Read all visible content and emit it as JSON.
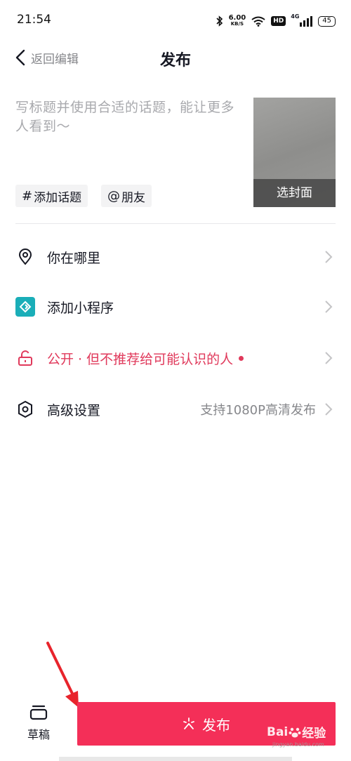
{
  "status_bar": {
    "time": "21:54",
    "net_speed": "6.00",
    "net_unit": "KB/S",
    "hd": "HD",
    "network": "4G",
    "battery": "45"
  },
  "nav": {
    "back_label": "返回编辑",
    "title": "发布"
  },
  "caption": {
    "placeholder": "写标题并使用合适的话题，能让更多人看到～"
  },
  "cover": {
    "label": "选封面"
  },
  "chips": {
    "topic_symbol": "#",
    "topic_label": "添加话题",
    "friend_symbol": "@",
    "friend_label": "朋友"
  },
  "rows": {
    "location": {
      "label": "你在哪里",
      "icon": "location-pin-icon"
    },
    "mini_program": {
      "label": "添加小程序",
      "icon": "mini-program-icon"
    },
    "privacy": {
      "label": "公开 · 但不推荐给可能认识的人",
      "icon": "unlock-icon",
      "color": "#e0395b"
    },
    "advanced": {
      "label": "高级设置",
      "value": "支持1080P高清发布",
      "icon": "hexagon-settings-icon"
    }
  },
  "footer": {
    "draft_label": "草稿",
    "publish_label": "发布",
    "publish_color": "#f42f58"
  },
  "watermark": {
    "brand": "Bai",
    "brand2": "经验",
    "url": "jingyan.baidu.com"
  }
}
